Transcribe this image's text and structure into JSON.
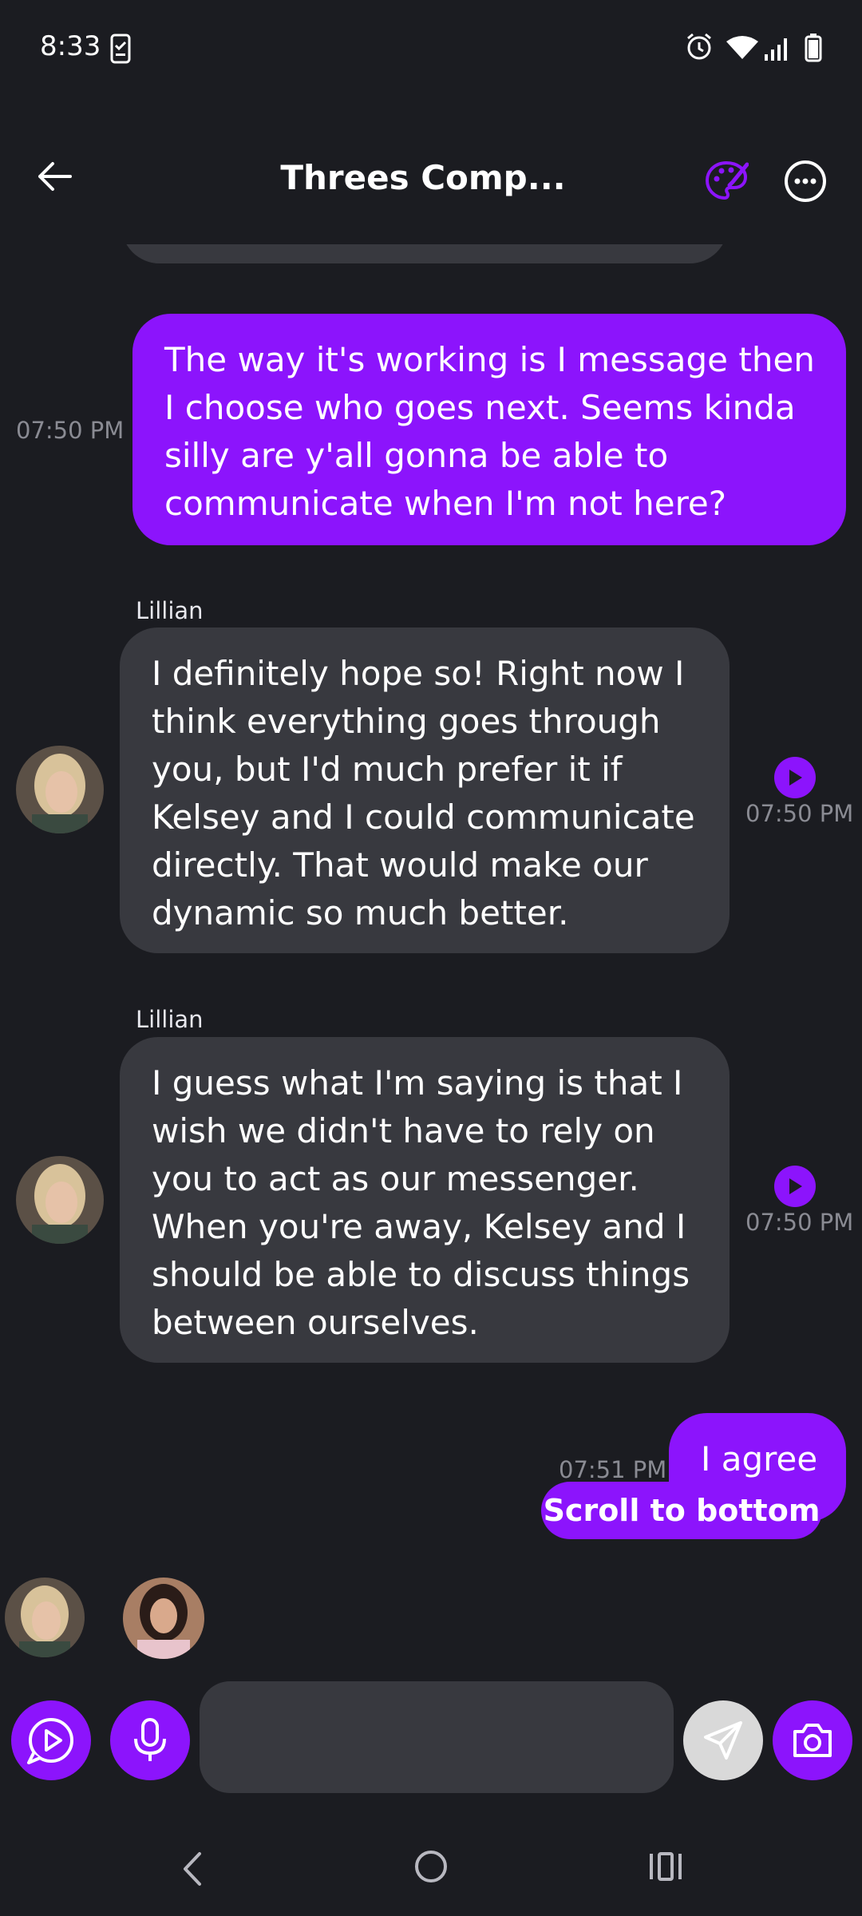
{
  "status_bar": {
    "time": "8:33"
  },
  "header": {
    "title": "Threes Comp..."
  },
  "messages": [
    {
      "type": "outgoing",
      "text": "The way it's working is I message then I choose who goes next. Seems kinda silly are y'all gonna be able to communicate when I'm not here?",
      "time": "07:50 PM"
    },
    {
      "type": "incoming",
      "sender": "Lillian",
      "text": "I definitely hope so! Right now I think everything goes through you, but I'd much prefer it if Kelsey and I could communicate directly. That would make our dynamic so much better.",
      "time": "07:50 PM"
    },
    {
      "type": "incoming",
      "sender": "Lillian",
      "text": "I guess what I'm saying is that I wish we didn't have to rely on you to act as our messenger. When you're away, Kelsey and I should be able to discuss things between ourselves.",
      "time": "07:50 PM"
    },
    {
      "type": "outgoing",
      "text": "I agree",
      "time": "07:51 PM"
    }
  ],
  "scroll_to_bottom": {
    "label": "Scroll to bottom"
  },
  "composer": {
    "value": "",
    "placeholder": ""
  },
  "colors": {
    "accent": "#8c14fc",
    "background": "#1b1c21",
    "incoming_bubble": "#38393f"
  }
}
